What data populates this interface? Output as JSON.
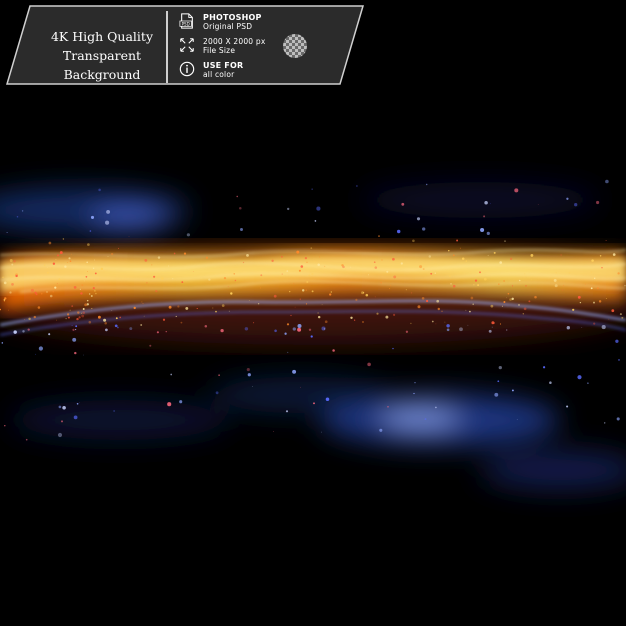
{
  "banner": {
    "quality_line1": "4K High Quality",
    "quality_line2": "Transparent Background",
    "software": "PHOTOSHOP",
    "format": "Original PSD",
    "dimensions": "2000 X 2000 px",
    "size_label": "File  Size",
    "use_title": "USE FOR",
    "use_desc": "all color",
    "icons": {
      "file": "psd-file-icon",
      "resize": "resize-arrows-icon",
      "info": "info-icon",
      "transparency": "transparency-checker-icon"
    }
  },
  "colors": {
    "background": "#000000",
    "banner_fill": "#2b2b2b",
    "banner_stroke": "#d0d0d0",
    "glow_core": "#ffd84a",
    "glow_orange": "#ff7a12",
    "glow_blue": "#4d6bff"
  }
}
